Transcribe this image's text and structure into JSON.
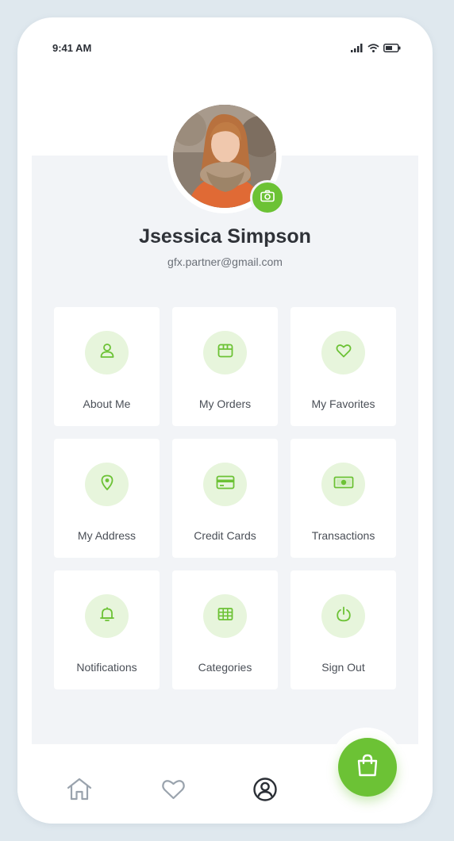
{
  "status_bar": {
    "time": "9:41 AM",
    "icons": [
      "signal-icon",
      "wifi-icon",
      "battery-icon"
    ]
  },
  "profile": {
    "name": "Jsessica Simpson",
    "email": "gfx.partner@gmail.com",
    "avatar_icon": "profile-photo",
    "edit_photo_icon": "camera-icon"
  },
  "menu": {
    "items": [
      {
        "label": "About Me",
        "icon": "user-icon"
      },
      {
        "label": "My Orders",
        "icon": "box-icon"
      },
      {
        "label": "My Favorites",
        "icon": "heart-icon"
      },
      {
        "label": "My Address",
        "icon": "location-pin-icon"
      },
      {
        "label": "Credit Cards",
        "icon": "credit-card-icon"
      },
      {
        "label": "Transactions",
        "icon": "banknote-icon"
      },
      {
        "label": "Notifications",
        "icon": "bell-icon"
      },
      {
        "label": "Categories",
        "icon": "grid-icon"
      },
      {
        "label": "Sign Out",
        "icon": "power-icon"
      }
    ]
  },
  "bottom_nav": {
    "items": [
      {
        "icon": "home-icon",
        "active": false
      },
      {
        "icon": "heart-icon",
        "active": false
      },
      {
        "icon": "profile-icon",
        "active": true
      }
    ],
    "fab_icon": "shopping-bag-icon"
  },
  "colors": {
    "accent": "#6cc235",
    "accent_light": "#e7f5dc",
    "background": "#f2f4f7",
    "text_dark": "#2f3238",
    "text_muted": "#6b7078"
  }
}
